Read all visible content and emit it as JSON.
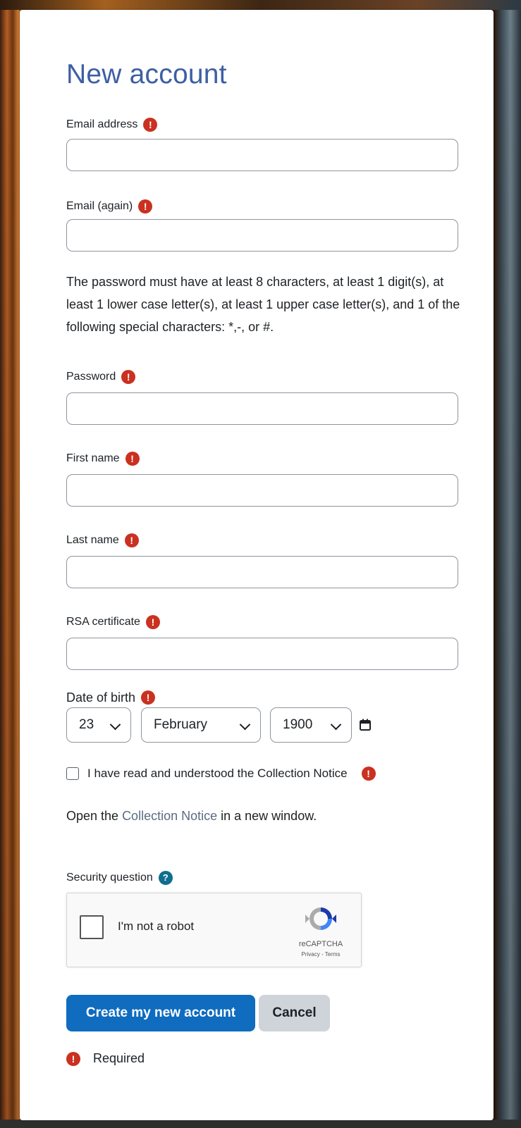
{
  "form": {
    "title": "New account",
    "fields": [
      {
        "label": "Email address",
        "value": ""
      },
      {
        "label": "Email (again)",
        "value": ""
      },
      {
        "label": "Password",
        "value": ""
      },
      {
        "label": "First name",
        "value": ""
      },
      {
        "label": "Last name",
        "value": ""
      },
      {
        "label": "RSA certificate",
        "value": ""
      }
    ],
    "password_policy": "The password must have at least 8 characters, at least 1 digit(s), at least 1 lower case letter(s), at least 1 upper case letter(s), and 1 of the following special characters: *,-, or #.",
    "dob": {
      "label": "Date of birth",
      "day": "23",
      "month": "February",
      "year": "1900"
    },
    "collection_notice": {
      "checkbox_label": "I have read and understood the Collection Notice",
      "open_prefix": "Open the ",
      "link_text": "Collection Notice",
      "open_suffix": " in a new window."
    },
    "security": {
      "label": "Security question",
      "recaptcha_label": "I'm not a robot",
      "recaptcha_brand": "reCAPTCHA",
      "recaptcha_privacy": "Privacy",
      "recaptcha_sep": " - ",
      "recaptcha_terms": "Terms"
    },
    "buttons": {
      "submit": "Create my new account",
      "cancel": "Cancel"
    },
    "required_legend": "Required"
  },
  "colors": {
    "primary": "#0f6cbf",
    "required": "#ca3120",
    "help": "#0f6e8e",
    "title": "#3d5fa3"
  },
  "icons": {
    "required": "!",
    "help": "?"
  }
}
